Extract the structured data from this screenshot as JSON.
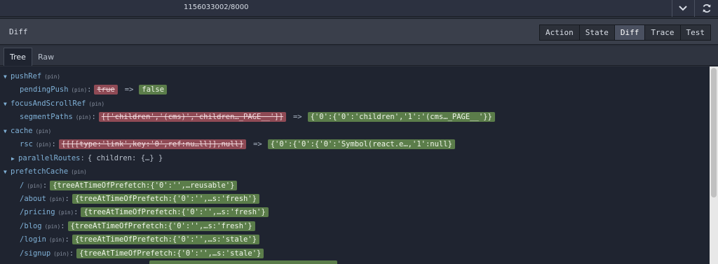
{
  "instance": "1156033002/8000",
  "header": {
    "title": "Diff",
    "tabs": [
      {
        "label": "Action",
        "active": false
      },
      {
        "label": "State",
        "active": false
      },
      {
        "label": "Diff",
        "active": true
      },
      {
        "label": "Trace",
        "active": false
      },
      {
        "label": "Test",
        "active": false
      }
    ]
  },
  "view_tabs": [
    {
      "label": "Tree",
      "active": true
    },
    {
      "label": "Raw",
      "active": false
    }
  ],
  "tree": {
    "pin": "(pin)",
    "arrow": "=>",
    "pushRef": {
      "key": "pushRef",
      "pendingPush": {
        "key": "pendingPush",
        "old": "true",
        "new": "false"
      }
    },
    "focusAndScrollRef": {
      "key": "focusAndScrollRef",
      "segmentPaths": {
        "key": "segmentPaths",
        "old": "[['children','(cms)','children…_PAGE__']]",
        "new": "{'0':{'0':'children','1':'(cms…_PAGE__'}}"
      }
    },
    "cache": {
      "key": "cache",
      "rsc": {
        "key": "rsc",
        "old": "[[[[type:'link',key:'0',ref:nu…ll]],null]",
        "new": "{'0':{'0':{'0':'Symbol(react.e…,'1':null}"
      },
      "parallelRoutes": {
        "key": "parallelRoutes",
        "value": "{ children: {…} }"
      }
    },
    "prefetchCache": {
      "key": "prefetchCache",
      "entries": [
        {
          "key": "/",
          "value": "{treeAtTimeOfPrefetch:{'0':'',…reusable'}"
        },
        {
          "key": "/about",
          "value": "{treeAtTimeOfPrefetch:{'0':'',…s:'fresh'}"
        },
        {
          "key": "/pricing",
          "value": "{treeAtTimeOfPrefetch:{'0':'',…s:'fresh'}"
        },
        {
          "key": "/blog",
          "value": "{treeAtTimeOfPrefetch:{'0':'',…s:'fresh'}"
        },
        {
          "key": "/login",
          "value": "{treeAtTimeOfPrefetch:{'0':'',…s:'stale'}"
        },
        {
          "key": "/signup",
          "value": "{treeAtTimeOfPrefetch:{'0':'',…s:'stale'}"
        }
      ]
    }
  }
}
